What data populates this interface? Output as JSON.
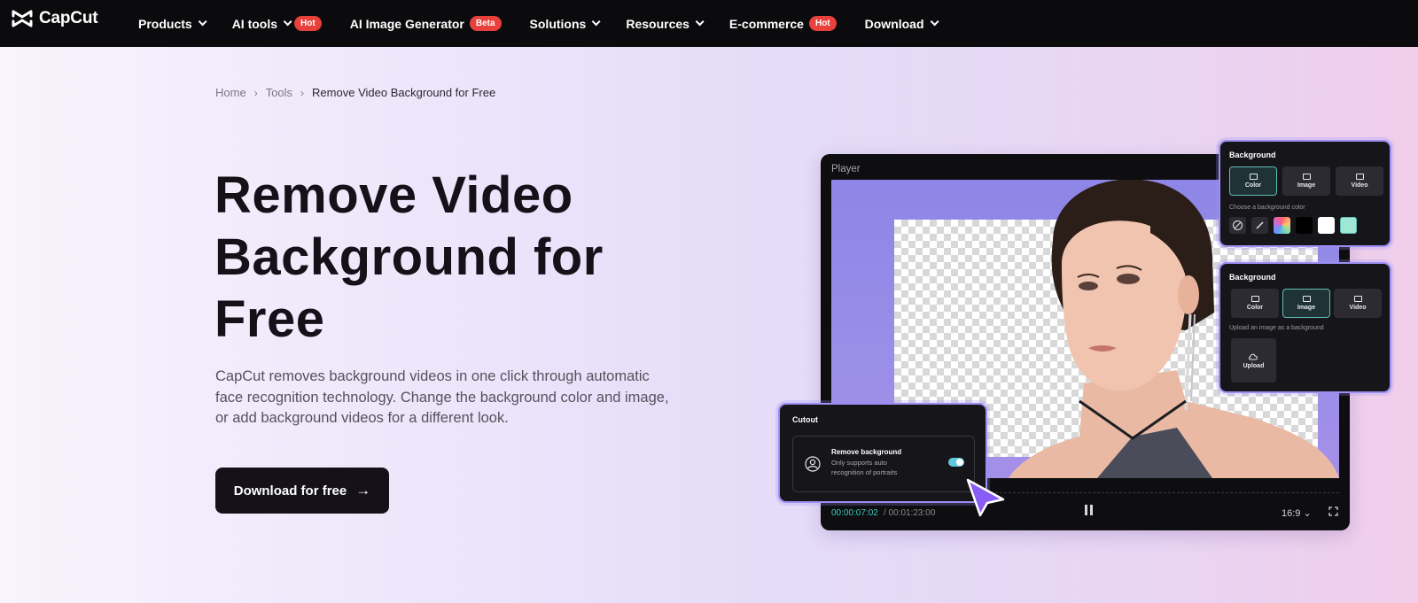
{
  "nav": {
    "logo_text": "CapCut",
    "items": [
      {
        "label": "Products",
        "dropdown": true,
        "badge": ""
      },
      {
        "label": "AI tools",
        "dropdown": true,
        "badge": "Hot"
      },
      {
        "label": "AI Image Generator",
        "dropdown": false,
        "badge": "Beta"
      },
      {
        "label": "Solutions",
        "dropdown": true,
        "badge": ""
      },
      {
        "label": "Resources",
        "dropdown": true,
        "badge": ""
      },
      {
        "label": "E-commerce",
        "dropdown": false,
        "badge": "Hot"
      },
      {
        "label": "Download",
        "dropdown": true,
        "badge": ""
      }
    ]
  },
  "breadcrumb": {
    "home": "Home",
    "tools": "Tools",
    "current": "Remove Video Background for Free",
    "separator": "›"
  },
  "hero": {
    "title_line1": "Remove Video",
    "title_line2": "Background for",
    "title_line3": "Free",
    "description": "CapCut removes background videos in one click through automatic face recognition technology. Change the background color and image, or add background videos for a different look.",
    "cta_label": "Download for free",
    "cta_arrow": "→"
  },
  "player": {
    "title": "Player",
    "time_current": "00:00:07:02",
    "time_total": "/ 00:01:23:00",
    "aspect_ratio": "16:9",
    "aspect_chevron": "⌄"
  },
  "background_panel_color": {
    "title": "Background",
    "tabs": [
      "Color",
      "Image",
      "Video"
    ],
    "active_tab": "Color",
    "hint": "Choose a background color",
    "swatches": [
      "#000000",
      "#ffffff",
      "#9fe6d4"
    ]
  },
  "background_panel_image": {
    "title": "Background",
    "tabs": [
      "Color",
      "Image",
      "Video"
    ],
    "active_tab": "Image",
    "hint": "Upload an image as a background",
    "upload_label": "Upload"
  },
  "cutout_panel": {
    "title": "Cutout",
    "option_title": "Remove background",
    "option_subtitle": "Only supports auto recognition of portraits",
    "toggle_on": true
  },
  "colors": {
    "nav_bg": "#0b0b0d",
    "badge_red": "#e8413c",
    "cta_bg": "#141218",
    "panel_border": "#9c8ef3",
    "accent_teal": "#3ec7c0",
    "cursor_purple": "#8a5cf6"
  }
}
